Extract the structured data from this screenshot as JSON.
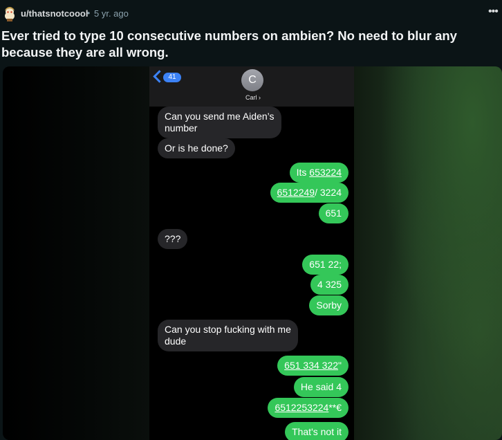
{
  "post": {
    "username": "u/thatsnotcoool",
    "separator": "•",
    "age": "5 yr. ago",
    "more_label": "•••",
    "title": "Ever tried to type 10 consecutive numbers on ambien? No need to blur any because they are all wrong."
  },
  "phone": {
    "back_count": "41",
    "contact_initial": "C",
    "contact_name": "Carl ›"
  },
  "messages": [
    {
      "dir": "in",
      "lines": [
        "Can you send me Aiden’s",
        "number"
      ]
    },
    {
      "dir": "in",
      "lines": [
        "Or is he done?"
      ]
    },
    {
      "dir": "out",
      "parts": [
        {
          "t": "Its "
        },
        {
          "t": "653224",
          "u": true
        }
      ]
    },
    {
      "dir": "out",
      "parts": [
        {
          "t": "6512249",
          "u": true
        },
        {
          "t": "/ 3224"
        }
      ]
    },
    {
      "dir": "out",
      "parts": [
        {
          "t": "651"
        }
      ]
    },
    {
      "dir": "in",
      "lines": [
        "???"
      ]
    },
    {
      "dir": "out",
      "parts": [
        {
          "t": "651 22;"
        }
      ]
    },
    {
      "dir": "out",
      "parts": [
        {
          "t": "4 325"
        }
      ]
    },
    {
      "dir": "out",
      "parts": [
        {
          "t": "Sorby"
        }
      ]
    },
    {
      "dir": "in",
      "lines": [
        "Can you stop fucking with me",
        "dude"
      ]
    },
    {
      "dir": "out",
      "parts": [
        {
          "t": "651 334 322",
          "u": true
        },
        {
          "t": "\""
        }
      ]
    },
    {
      "dir": "out",
      "parts": [
        {
          "t": "He said 4"
        }
      ]
    },
    {
      "dir": "out",
      "parts": [
        {
          "t": "6512253224",
          "u": true
        },
        {
          "t": "**€"
        }
      ]
    },
    {
      "dir": "out",
      "parts": [
        {
          "t": "That's not it"
        }
      ]
    }
  ],
  "colors": {
    "incoming_bubble": "#262629",
    "outgoing_bubble": "#34c759",
    "back_accent": "#3c82f6"
  }
}
